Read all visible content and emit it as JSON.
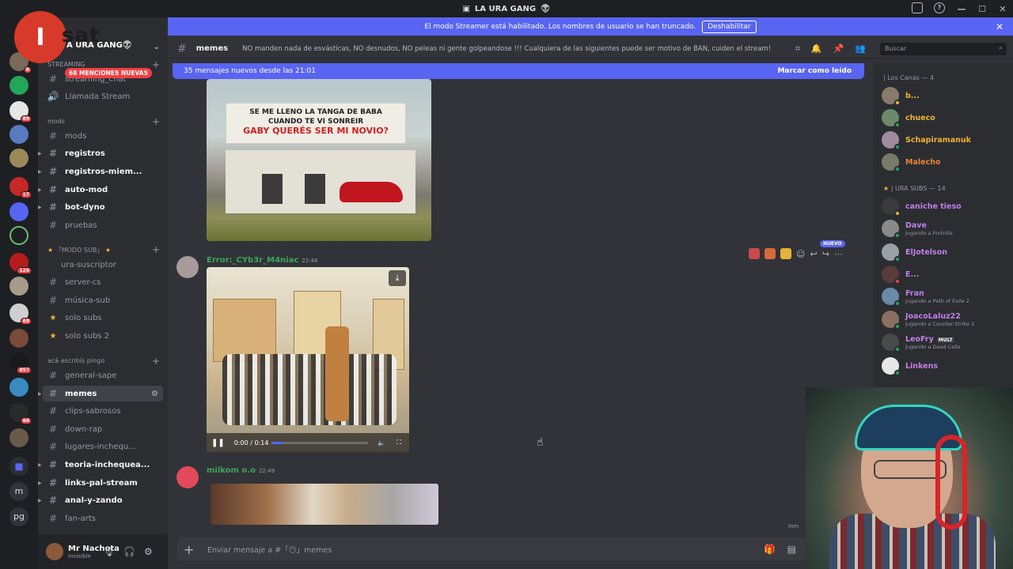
{
  "window": {
    "title": "LA URA GANG",
    "title_emoji": "👽"
  },
  "overlay_logo": {
    "letter": "I",
    "text": "sat"
  },
  "streamer_banner": {
    "text": "El modo Streamer está habilitado. Los nombres de usuario se han truncado.",
    "button": "Deshabilitar"
  },
  "server": {
    "name": "A URA GANG👽",
    "mentions_badge": "68 MENCIONES NUEVAS"
  },
  "guild_badges": [
    "8",
    "89",
    "17",
    "126",
    "68",
    "857",
    "66"
  ],
  "guild_letters": [
    "m",
    "pg"
  ],
  "channels": {
    "streaming_label": "STREAMING",
    "streaming_chat": "streaming_chat",
    "llamada": "Llamada Stream",
    "mods_cat": "mods",
    "mods": "mods",
    "registros": "registros",
    "registros_miem": "registros-miem...",
    "auto_mod": "auto-mod",
    "bot_dyno": "bot-dyno",
    "pruebas": "pruebas",
    "modo_sub_cat": "「MODO SUB」",
    "ura_suscriptor": "ura-suscriptor",
    "server_cs": "server-cs",
    "musica_sub": "música-sub",
    "solo_subs": "solo subs",
    "solo_subs2": "solo subs 2",
    "aca_cat": "acá escribís pingo",
    "general_sape": "general-sape",
    "memes": "memes",
    "clips": "clips-sabrosos",
    "down_rap": "down-rap",
    "lugares": "lugares-inchequ...",
    "teoria": "teoria-inchequea...",
    "links": "links-pal-stream",
    "anal": "anal-y-zando",
    "fan_arts": "fan-arts"
  },
  "user": {
    "name": "Mr Nachota",
    "status": "Invisible"
  },
  "channel_header": {
    "name": "memes",
    "topic": "NO manden nada de esvásticas, NO desnudos, NO peleas ni gente golpeandose !!! Cualquiera de las siguientes puede ser motivo de BAN, cuiden el stream!"
  },
  "search": {
    "placeholder": "Buscar"
  },
  "new_messages": {
    "text": "35 mensajes nuevos desde las 21:01",
    "mark_read": "Marcar como leído"
  },
  "image1_sign": {
    "line1": "SE ME LLENO LA TANGA DE BABA",
    "line2": "CUANDO TE VI SONREIR",
    "line3": "GABY QUERÉS SER MI NOVIO?"
  },
  "messages": [
    {
      "author": "Error:_CYb3r_M4niac",
      "time": "22:46",
      "author_color": "#3ba55c"
    },
    {
      "author": "milkom o.o",
      "time": "22:49",
      "author_color": "#3ba55c"
    }
  ],
  "video": {
    "time": "0:00 / 0:14",
    "progress": 0.12
  },
  "nuevo_tag": "NUEVO",
  "composer": {
    "placeholder": "Enviar mensaje a #「😶」memes"
  },
  "members": {
    "cat1": "| Los Canas — 4",
    "cat2": "| URA SUBS — 14",
    "list1": [
      {
        "name": "b...",
        "color": "#f0b232"
      },
      {
        "name": "chueco",
        "color": "#f0b232"
      },
      {
        "name": "Schapiramanuk",
        "color": "#f0b232"
      },
      {
        "name": "Malecho",
        "color": "#f08232"
      }
    ],
    "list2": [
      {
        "name": "caniche tieso",
        "color": "#c27ee8",
        "status": ""
      },
      {
        "name": "Dave",
        "color": "#c27ee8",
        "status": "Jugando a Fortnite"
      },
      {
        "name": "ElJotelson",
        "color": "#c27ee8",
        "status": ""
      },
      {
        "name": "E...",
        "color": "#c27ee8",
        "status": ""
      },
      {
        "name": "Fran",
        "color": "#c27ee8",
        "status": "Jugando a Path of Exile 2"
      },
      {
        "name": "JoacoLaluz22",
        "color": "#c27ee8",
        "status": "Jugando a Counter-Strike 2"
      },
      {
        "name": "LeoFry",
        "color": "#c27ee8",
        "status": "Jugando a Dead Cells",
        "tag": "MULT"
      },
      {
        "name": "Linkens",
        "color": "#c27ee8",
        "status": ""
      }
    ]
  },
  "misc": {
    "lamp_text": "Inm"
  }
}
